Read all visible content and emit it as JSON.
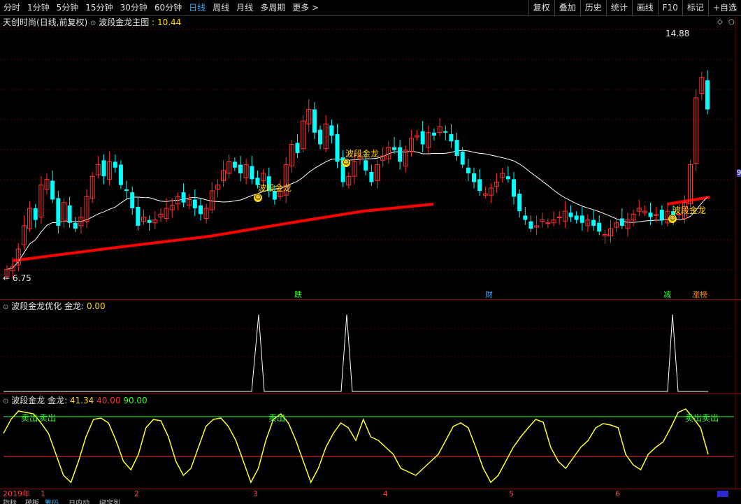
{
  "toolbar": {
    "timeframes": [
      "分时",
      "1分钟",
      "5分钟",
      "15分钟",
      "30分钟",
      "60分钟",
      "日线",
      "周线",
      "月线",
      "多周期",
      "更多 >"
    ],
    "active": "日线",
    "tools": [
      "复权",
      "叠加",
      "历史",
      "统计",
      "画线",
      "F10",
      "标记",
      "+自选"
    ]
  },
  "main_panel": {
    "stock_name": "天创时尚",
    "mode": "(日线,前复权)",
    "indicator_name": "波段金龙主图",
    "indicator_value": ": 10.44",
    "high_label": "14.88",
    "low_label": "6.75",
    "signal_label": "波段金龙",
    "events": [
      {
        "text": "跌",
        "color": "#32ff32"
      },
      {
        "text": "财",
        "color": "#3fa9f5"
      },
      {
        "text": "减",
        "color": "#32ff32"
      },
      {
        "text": "涨榜",
        "color": "#ff8c00"
      }
    ],
    "right_edge_value": "9"
  },
  "sub_panel_1": {
    "name": "波段金龙优化",
    "label": "金龙:",
    "value": "0.00"
  },
  "sub_panel_2": {
    "name": "波段金龙",
    "label": "金龙:",
    "value": "41.34",
    "value_red": "40.00",
    "value_green": "90.00",
    "signal_sell": "卖出"
  },
  "x_axis": {
    "year_label": "2019年",
    "months": [
      "1",
      "2",
      "3",
      "4",
      "5",
      "6"
    ]
  },
  "bottom_tabs": [
    "指标",
    "模板",
    "筹码",
    "日内动",
    "绑定列"
  ],
  "colors": {
    "up": "#ff3030",
    "down": "#00ffff",
    "ma_white": "#ffffff",
    "trend_red": "#ff0000",
    "osc_yellow": "#ffff33",
    "line_green": "#32ff32",
    "line_red": "#ff3030"
  },
  "chart_data": [
    {
      "type": "candlestick",
      "title": "波段金龙主图",
      "ylim": [
        6.5,
        15.2
      ],
      "high": 14.88,
      "low": 6.75
    },
    {
      "type": "line",
      "title": "波段金龙优化",
      "series": [
        {
          "name": "金龙",
          "values": [
            0,
            0,
            0,
            0,
            1,
            0,
            0,
            0,
            1,
            0,
            0,
            0,
            0,
            0,
            0,
            0,
            0,
            0,
            1,
            0
          ]
        }
      ],
      "ylim": [
        0,
        1
      ]
    },
    {
      "type": "line",
      "title": "波段金龙",
      "series": [
        {
          "name": "金龙",
          "values": [
            85,
            95,
            88,
            60,
            35,
            20,
            70,
            90,
            75,
            40,
            25,
            30,
            70,
            90,
            75,
            35,
            20,
            85,
            90,
            41.34
          ]
        }
      ],
      "ylim": [
        0,
        100
      ],
      "reference_lines": [
        40,
        90
      ]
    }
  ]
}
